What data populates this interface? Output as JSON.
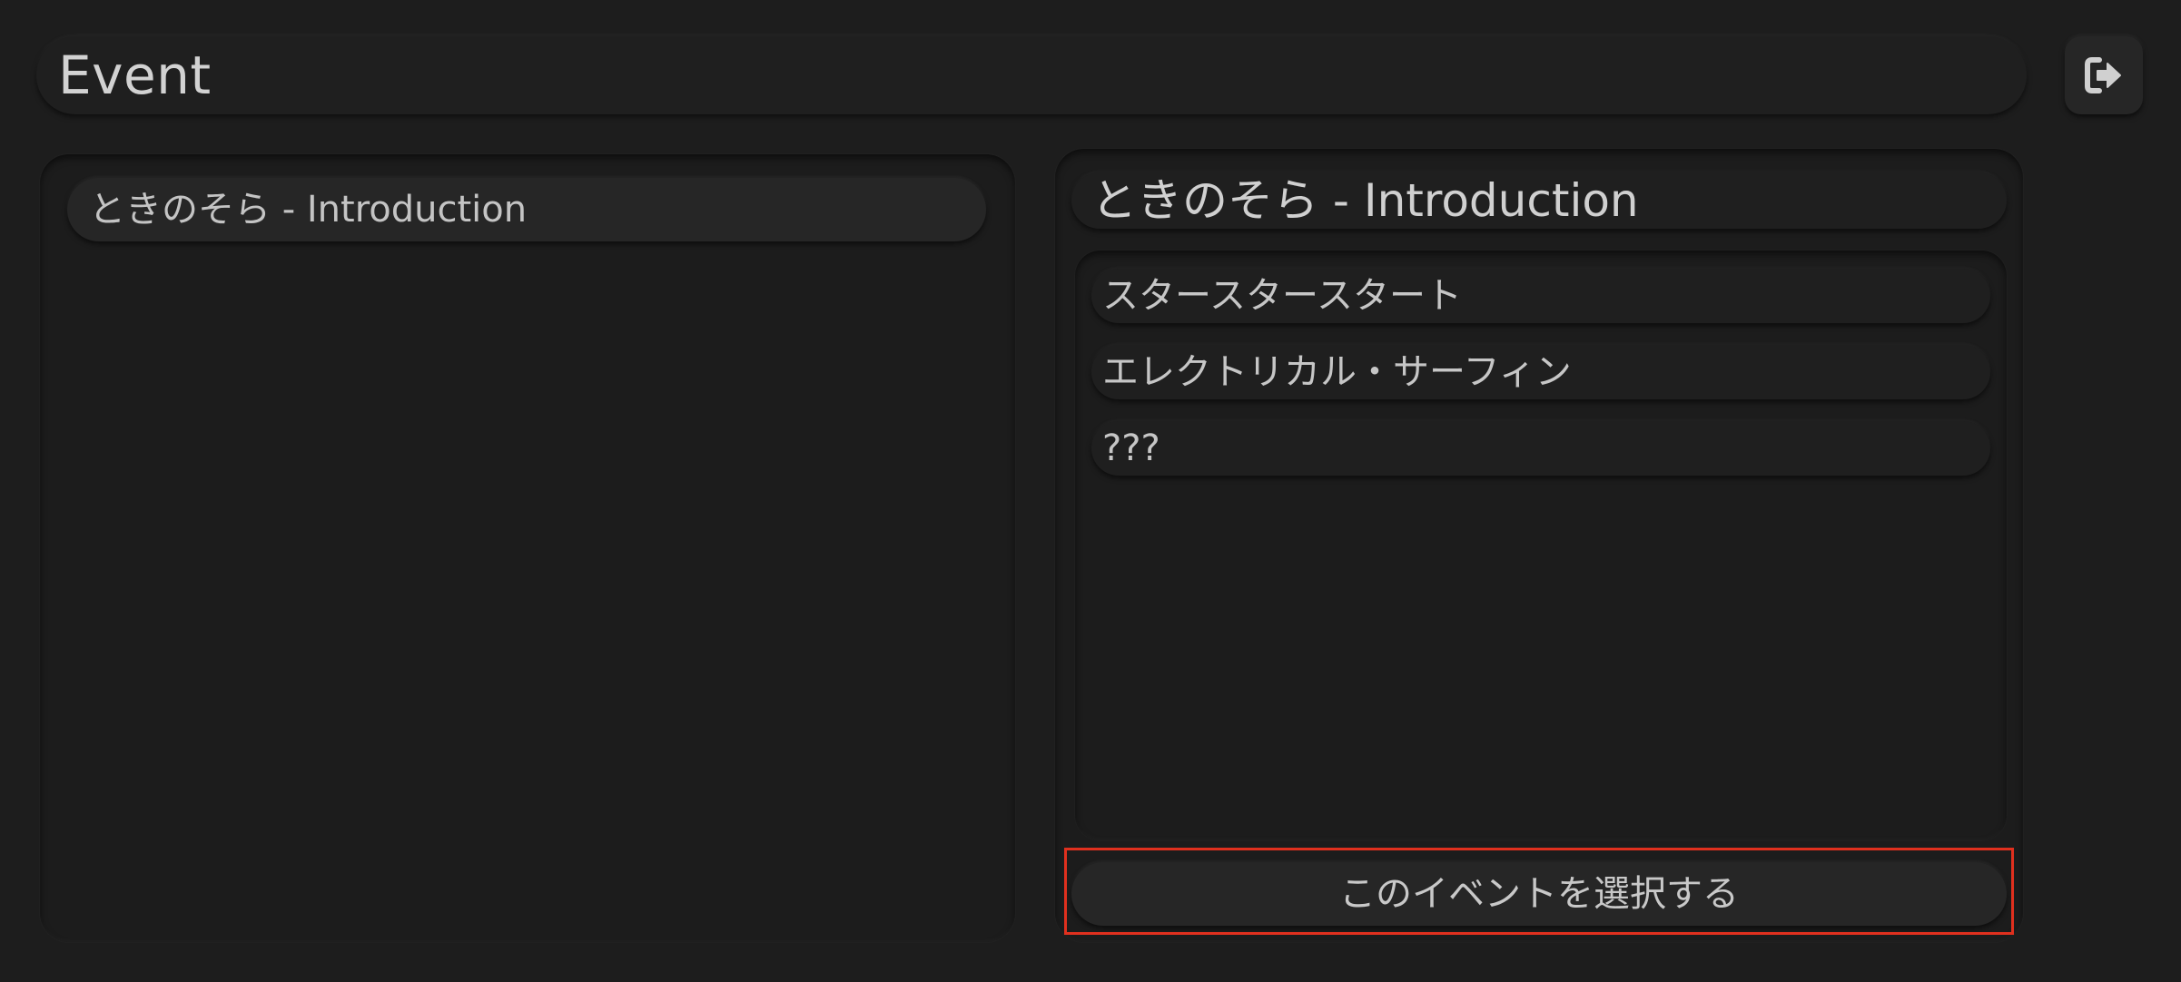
{
  "header": {
    "title": "Event",
    "exit_icon": "sign-out-icon"
  },
  "event_list": {
    "items": [
      {
        "label": "ときのそら - Introduction"
      }
    ]
  },
  "detail": {
    "title": "ときのそら - Introduction",
    "tracks": [
      {
        "label": "スタースタースタート"
      },
      {
        "label": "エレクトリカル・サーフィン"
      },
      {
        "label": "???"
      }
    ],
    "select_button_label": "このイベントを選択する"
  },
  "colors": {
    "background": "#1d1d1d",
    "highlight": "#e0301e"
  }
}
